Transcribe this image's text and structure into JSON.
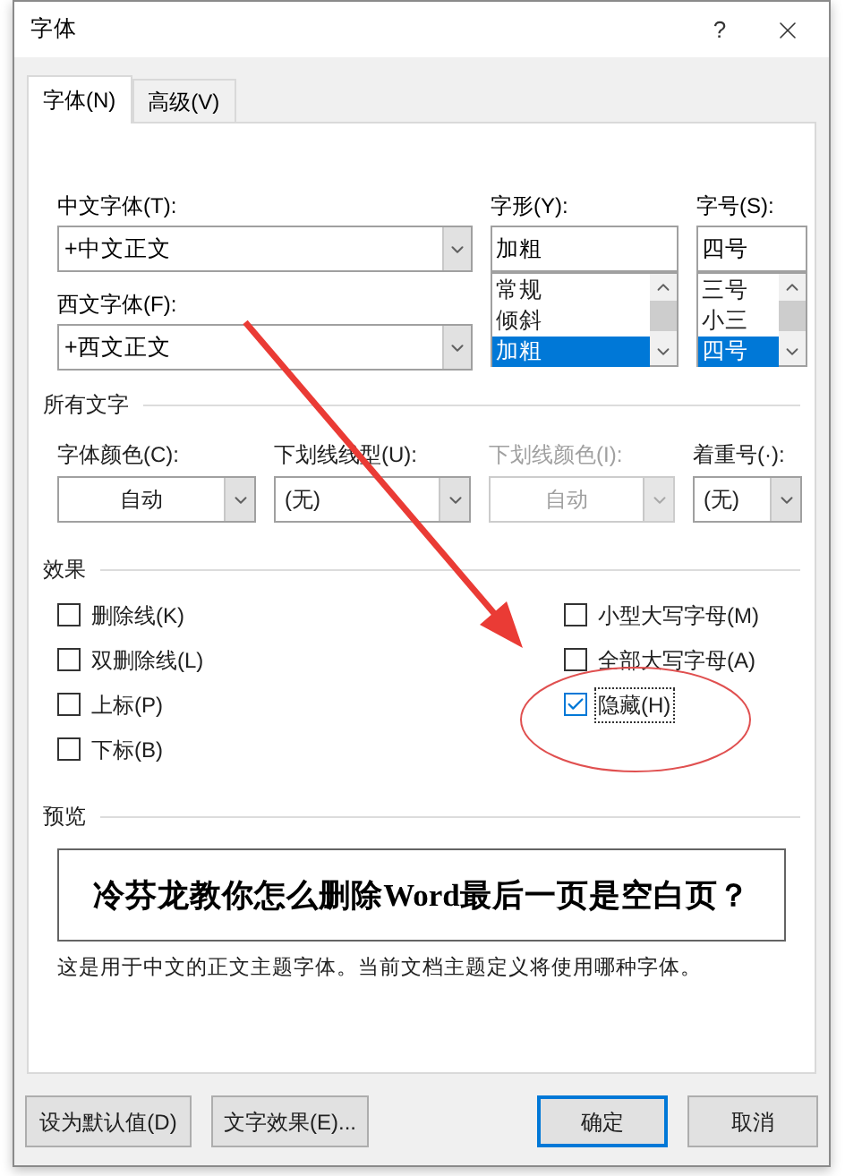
{
  "window": {
    "title": "字体",
    "help": "?"
  },
  "tabs": [
    {
      "label": "字体(N)",
      "selected": true
    },
    {
      "label": "高级(V)",
      "selected": false
    }
  ],
  "font_fields": [
    {
      "label": "中文字体(T):",
      "value": "+中文正文"
    },
    {
      "label": "西文字体(F):",
      "value": "+西文正文"
    }
  ],
  "style": {
    "label": "字形(Y):",
    "value": "加粗",
    "options": [
      {
        "label": "常规",
        "selected": false
      },
      {
        "label": "倾斜",
        "selected": false
      },
      {
        "label": "加粗",
        "selected": true
      }
    ]
  },
  "size": {
    "label": "字号(S):",
    "value": "四号",
    "options": [
      {
        "label": "三号",
        "selected": false
      },
      {
        "label": "小三",
        "selected": false
      },
      {
        "label": "四号",
        "selected": true
      }
    ]
  },
  "all_text": {
    "heading": "所有文字",
    "dropdowns": [
      {
        "kind": "color",
        "label": "字体颜色(C):",
        "value": "自动",
        "disabled": false
      },
      {
        "kind": "list",
        "label": "下划线线型(U):",
        "value": "(无)",
        "disabled": false
      },
      {
        "kind": "color",
        "label": "下划线颜色(I):",
        "value": "自动",
        "disabled": true
      },
      {
        "kind": "list",
        "label": "着重号(·):",
        "value": "(无)",
        "disabled": false
      }
    ]
  },
  "effects": {
    "heading": "效果",
    "left": [
      {
        "label": "删除线(K)",
        "checked": false,
        "focused": false
      },
      {
        "label": "双删除线(L)",
        "checked": false,
        "focused": false
      },
      {
        "label": "上标(P)",
        "checked": false,
        "focused": false
      },
      {
        "label": "下标(B)",
        "checked": false,
        "focused": false
      }
    ],
    "right": [
      {
        "label": "小型大写字母(M)",
        "checked": false,
        "focused": false
      },
      {
        "label": "全部大写字母(A)",
        "checked": false,
        "focused": false
      },
      {
        "label": "隐藏(H)",
        "checked": true,
        "focused": true
      }
    ]
  },
  "preview": {
    "heading": "预览",
    "sample": "冷芬龙教你怎么删除Word最后一页是空白页？",
    "note": "这是用于中文的正文主题字体。当前文档主题定义将使用哪种字体。"
  },
  "left_buttons": [
    {
      "label": "设为默认值(D)",
      "default": false
    },
    {
      "label": "文字效果(E)...",
      "default": false
    }
  ],
  "right_buttons": [
    {
      "label": "确定",
      "default": true
    },
    {
      "label": "取消",
      "default": false
    }
  ]
}
